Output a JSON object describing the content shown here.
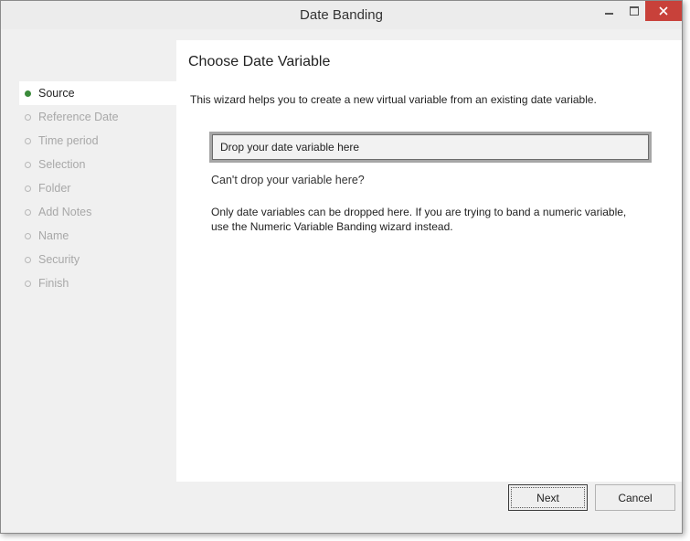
{
  "window": {
    "title": "Date Banding"
  },
  "sidebar": {
    "steps": [
      {
        "label": "Source",
        "active": true
      },
      {
        "label": "Reference Date",
        "active": false
      },
      {
        "label": "Time period",
        "active": false
      },
      {
        "label": "Selection",
        "active": false
      },
      {
        "label": "Folder",
        "active": false
      },
      {
        "label": "Add Notes",
        "active": false
      },
      {
        "label": "Name",
        "active": false
      },
      {
        "label": "Security",
        "active": false
      },
      {
        "label": "Finish",
        "active": false
      }
    ]
  },
  "main": {
    "heading": "Choose Date Variable",
    "intro": "This wizard helps you to create a new virtual variable from an existing date variable.",
    "dropzone_text": "Drop your date variable here",
    "cant_drop": "Can't drop your variable here?",
    "help_text": "Only date variables can be dropped here. If you are trying to band a numeric variable, use the Numeric Variable Banding wizard instead."
  },
  "footer": {
    "next_label": "Next",
    "cancel_label": "Cancel"
  },
  "colors": {
    "active_dot": "#3a8a3a",
    "close_button": "#c8413a"
  }
}
